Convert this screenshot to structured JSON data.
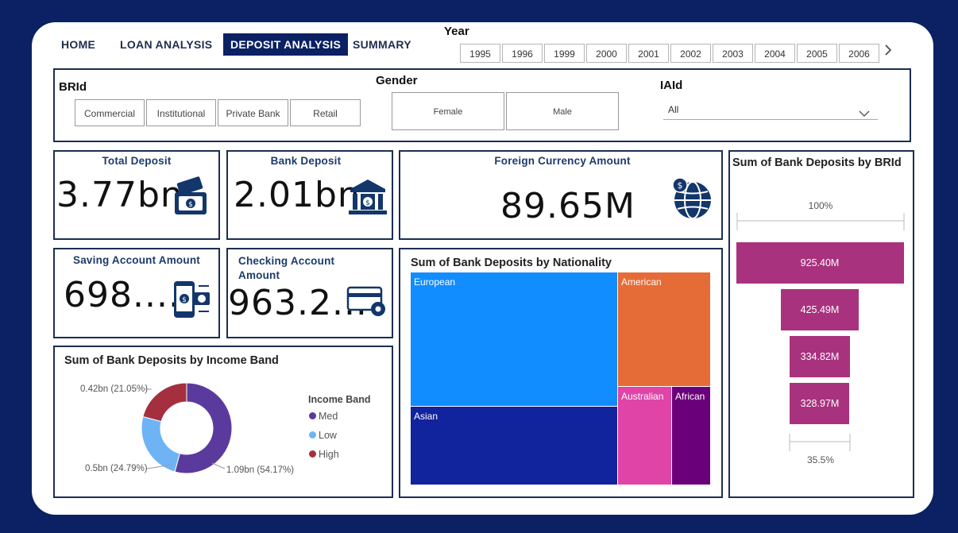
{
  "nav": {
    "home": "HOME",
    "loan": "LOAN ANALYSIS",
    "deposit": "DEPOSIT ANALYSIS",
    "summary": "SUMMARY"
  },
  "year_slicer": {
    "title": "Year",
    "years": [
      "1995",
      "1996",
      "1999",
      "2000",
      "2001",
      "2002",
      "2003",
      "2004",
      "2005",
      "2006"
    ]
  },
  "brid_slicer": {
    "title": "BRId",
    "options": [
      "Commercial",
      "Institutional",
      "Private Bank",
      "Retail"
    ]
  },
  "gender_slicer": {
    "title": "Gender",
    "options": [
      "Female",
      "Male"
    ]
  },
  "iaid_slicer": {
    "title": "IAId",
    "selected": "All"
  },
  "cards": {
    "total_deposit": {
      "title": "Total Deposit",
      "value": "3.77bn"
    },
    "bank_deposit": {
      "title": "Bank Deposit",
      "value": "2.01bn"
    },
    "foreign_currency": {
      "title": "Foreign Currency Amount",
      "value": "89.65M"
    },
    "saving_account": {
      "title": "Saving Account Amount",
      "value": "698...."
    },
    "checking_account": {
      "title": "Checking Account Amount",
      "value": "963.2..."
    }
  },
  "colors": {
    "navy": "#0b2163",
    "med": "#5b3a9e",
    "low": "#6eb4f5",
    "high": "#a4303f",
    "funnel": "#a8327e"
  },
  "chart_data": [
    {
      "type": "pie",
      "title": "Sum of Bank Deposits by Income Band",
      "legend_title": "Income Band",
      "legend_position": "right",
      "categories": [
        "Med",
        "Low",
        "High"
      ],
      "values": [
        1.09,
        0.5,
        0.42
      ],
      "percent": [
        54.17,
        24.79,
        21.05
      ],
      "data_labels": [
        "1.09bn (54.17%)",
        "0.5bn (24.79%)",
        "0.42bn (21.05%)"
      ],
      "colors": [
        "#5b3a9e",
        "#6eb4f5",
        "#a4303f"
      ]
    },
    {
      "type": "treemap",
      "title": "Sum of Bank Deposits by Nationality",
      "categories": [
        "European",
        "Asian",
        "American",
        "Australian",
        "African"
      ],
      "colors": [
        "#118dff",
        "#12239e",
        "#e66c37",
        "#e044a7",
        "#6b007b"
      ]
    },
    {
      "type": "funnel",
      "title": "Sum of Bank Deposits by BRId",
      "values": [
        925.4,
        425.49,
        334.82,
        328.97
      ],
      "data_labels": [
        "925.40M",
        "425.49M",
        "334.82M",
        "328.97M"
      ],
      "top_percent": "100%",
      "bottom_percent": "35.5%"
    }
  ]
}
